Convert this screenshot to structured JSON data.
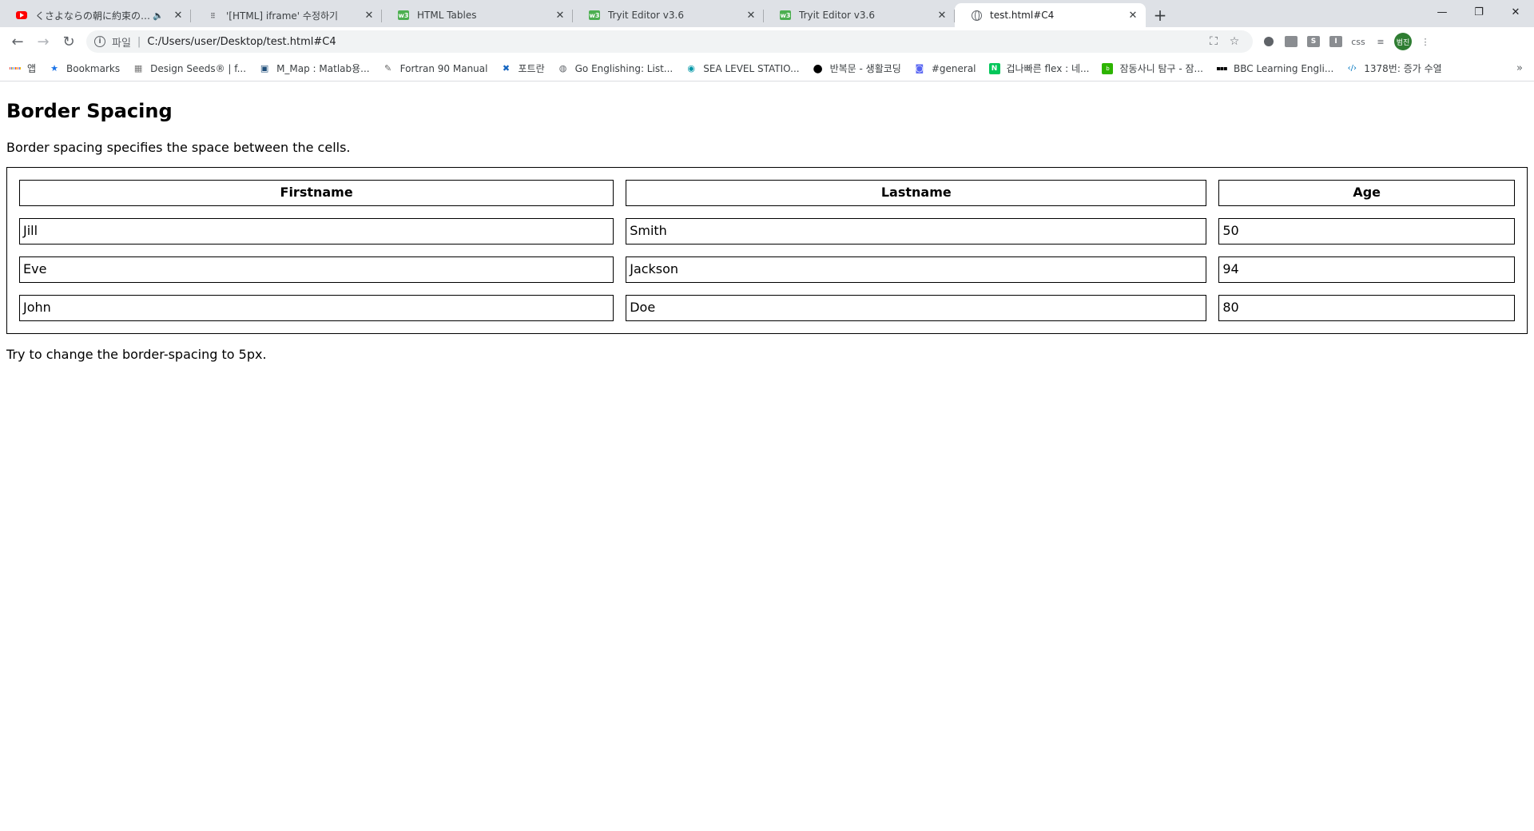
{
  "browser": {
    "tabs": [
      {
        "title": "くさよならの朝に約束の花を",
        "favicon": "youtube-icon",
        "audio": true,
        "active": false
      },
      {
        "title": "'[HTML] iframe' 수정하기",
        "favicon": "dots-icon",
        "audio": false,
        "active": false
      },
      {
        "title": "HTML Tables",
        "favicon": "w3schools-icon",
        "audio": false,
        "active": false
      },
      {
        "title": "Tryit Editor v3.6",
        "favicon": "w3schools-icon",
        "audio": false,
        "active": false
      },
      {
        "title": "Tryit Editor v3.6",
        "favicon": "w3schools-icon",
        "audio": false,
        "active": false
      },
      {
        "title": "test.html#C4",
        "favicon": "globe-icon",
        "audio": false,
        "active": true
      }
    ],
    "omnibox": {
      "scheme_label": "파일",
      "url": "C:/Users/user/Desktop/test.html#C4"
    },
    "profile_initials": "범진",
    "ext_labels": {
      "ext1": "",
      "ext2": "",
      "ext3": "S",
      "ext4": "I",
      "ext5": "css"
    },
    "bookmarks": [
      {
        "label": "앱",
        "icon": "apps-grid-icon"
      },
      {
        "label": "Bookmarks",
        "icon": "star-icon"
      },
      {
        "label": "Design Seeds® | f...",
        "icon": "design-seeds-icon"
      },
      {
        "label": "M_Map : Matlab용...",
        "icon": "mmap-icon"
      },
      {
        "label": "Fortran 90 Manual",
        "icon": "fortran-icon"
      },
      {
        "label": "포트란",
        "icon": "cross-icon"
      },
      {
        "label": "Go Englishing: List...",
        "icon": "globe-icon"
      },
      {
        "label": "SEA LEVEL STATIO...",
        "icon": "sea-level-icon"
      },
      {
        "label": "반복문 - 생활코딩",
        "icon": "black-circle-icon"
      },
      {
        "label": "#general",
        "icon": "discord-icon"
      },
      {
        "label": "겁나빠른 flex : 네...",
        "icon": "naver-icon"
      },
      {
        "label": "잠동사니 탐구 - 잠...",
        "icon": "blog-icon"
      },
      {
        "label": "BBC Learning Engli...",
        "icon": "bbc-icon"
      },
      {
        "label": "1378번: 증가 수열",
        "icon": "code-icon"
      }
    ]
  },
  "page": {
    "heading": "Border Spacing",
    "intro": "Border spacing specifies the space between the cells.",
    "table": {
      "headers": [
        "Firstname",
        "Lastname",
        "Age"
      ],
      "rows": [
        [
          "Jill",
          "Smith",
          "50"
        ],
        [
          "Eve",
          "Jackson",
          "94"
        ],
        [
          "John",
          "Doe",
          "80"
        ]
      ]
    },
    "outro": "Try to change the border-spacing to 5px."
  }
}
